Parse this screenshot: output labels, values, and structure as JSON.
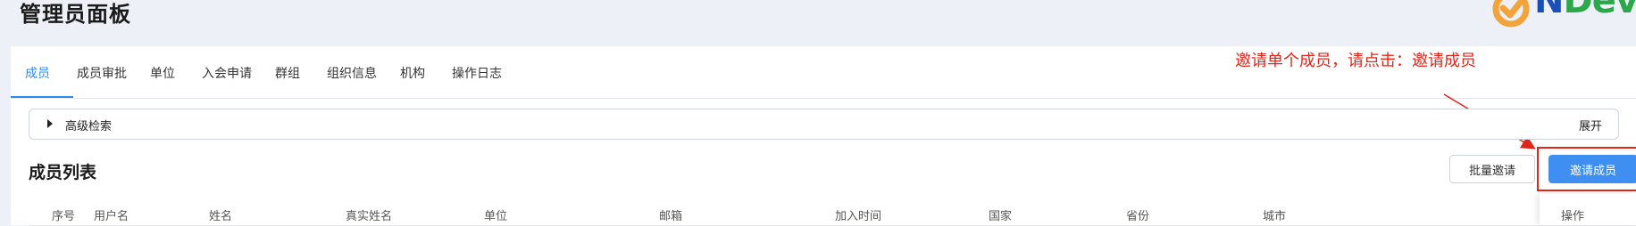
{
  "header": {
    "title": "管理员面板",
    "logo_text_a": "N",
    "logo_text_b": "Dev"
  },
  "tabs": [
    {
      "label": "成员",
      "active": true
    },
    {
      "label": "成员审批",
      "active": false
    },
    {
      "label": "单位",
      "active": false
    },
    {
      "label": "入会申请",
      "active": false
    },
    {
      "label": "群组",
      "active": false
    },
    {
      "label": "组织信息",
      "active": false
    },
    {
      "label": "机构",
      "active": false
    },
    {
      "label": "操作日志",
      "active": false
    }
  ],
  "annotation": {
    "text": "邀请单个成员，请点击：邀请成员",
    "color": "#e0261b"
  },
  "advanced_search": {
    "label": "高级检索",
    "expand_label": "展开"
  },
  "member_list": {
    "title": "成员列表",
    "batch_invite_label": "批量邀请",
    "invite_label": "邀请成员",
    "columns": [
      "序号",
      "用户名",
      "姓名",
      "真实姓名",
      "单位",
      "邮箱",
      "加入时间",
      "国家",
      "省份",
      "城市",
      "操作"
    ]
  },
  "colors": {
    "accent": "#2d8cf0",
    "primary_button": "#3f8ff2",
    "background": "#eef0f7"
  }
}
